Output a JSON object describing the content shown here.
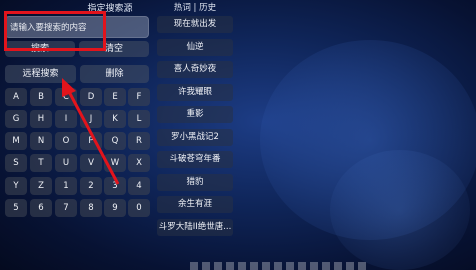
{
  "source_label": "指定搜索源",
  "search": {
    "placeholder": "请输入要搜索的内容"
  },
  "buttons": {
    "search": "搜索",
    "clear": "清空",
    "remote_search": "远程搜索",
    "delete": "删除"
  },
  "keys": [
    [
      "A",
      "B",
      "C",
      "D",
      "E",
      "F"
    ],
    [
      "G",
      "H",
      "I",
      "J",
      "K",
      "L"
    ],
    [
      "M",
      "N",
      "O",
      "P",
      "Q",
      "R"
    ],
    [
      "S",
      "T",
      "U",
      "V",
      "W",
      "X"
    ],
    [
      "Y",
      "Z",
      "1",
      "2",
      "3",
      "4"
    ],
    [
      "5",
      "6",
      "7",
      "8",
      "9",
      "0"
    ]
  ],
  "hot": {
    "header": "热词 | 历史",
    "items": [
      "现在就出发",
      "仙逆",
      "喜人奇妙夜",
      "许我耀眼",
      "重影",
      "罗小黑战记2",
      "斗破苍穹年番",
      "猎豹",
      "余生有涯",
      "斗罗大陆II绝世唐..."
    ]
  },
  "colors": {
    "annotation": "#e2141c"
  }
}
